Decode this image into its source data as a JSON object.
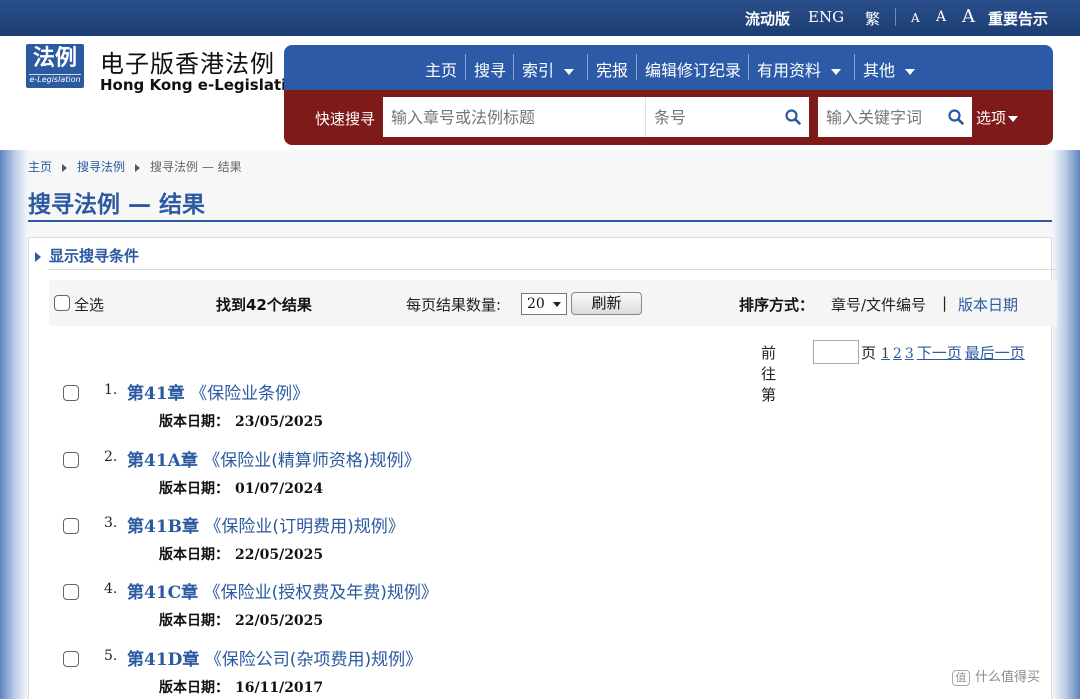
{
  "topbar": {
    "mobile": "流动版",
    "english": "ENG",
    "traditional": "繁",
    "font_small": "A",
    "font_medium": "A",
    "font_large": "A",
    "notice": "重要告示"
  },
  "header": {
    "logo_cn": "法例",
    "logo_en": "e-Legislation",
    "site_cn": "电子版香港法例",
    "site_en": "Hong Kong e-Legislation"
  },
  "nav": {
    "home": "主页",
    "search": "搜寻",
    "index": "索引",
    "constitution": "宪报",
    "editorial": "编辑修订纪录",
    "useful": "有用资料",
    "others": "其他"
  },
  "quick_search": {
    "label": "快速搜寻",
    "chapter_placeholder": "输入章号或法例标题",
    "section_placeholder": "条号",
    "keyword_placeholder": "输入关键字词",
    "options": "选项"
  },
  "breadcrumb": {
    "home": "主页",
    "search": "搜寻法例",
    "current": "搜寻法例 — 结果"
  },
  "page_title": "搜寻法例 — 结果",
  "search_conditions": "显示搜寻条件",
  "toolbar": {
    "select_all": "全选",
    "found": "找到42个结果",
    "per_page_label": "每页结果数量:",
    "per_page_value": "20",
    "refresh": "刷新",
    "sort_label": "排序方式：",
    "sort_chapter": "章号/文件编号",
    "sort_sep": "|",
    "sort_date": "版本日期"
  },
  "pager": {
    "goto": "前往第",
    "page": "页",
    "current": "1",
    "p2": "2",
    "p3": "3",
    "next": "下一页",
    "last": "最后一页"
  },
  "results": [
    {
      "index": "1.",
      "chapter": "第41章",
      "title": "《保险业条例》",
      "version_label": "版本日期：",
      "version_date": "23/05/2025"
    },
    {
      "index": "2.",
      "chapter": "第41A章",
      "title": "《保险业(精算师资格)规例》",
      "version_label": "版本日期：",
      "version_date": "01/07/2024"
    },
    {
      "index": "3.",
      "chapter": "第41B章",
      "title": "《保险业(订明费用)规例》",
      "version_label": "版本日期：",
      "version_date": "22/05/2025"
    },
    {
      "index": "4.",
      "chapter": "第41C章",
      "title": "《保险业(授权费及年费)规例》",
      "version_label": "版本日期：",
      "version_date": "22/05/2025"
    },
    {
      "index": "5.",
      "chapter": "第41D章",
      "title": "《保险公司(杂项费用)规例》",
      "version_label": "版本日期：",
      "version_date": "16/11/2017"
    }
  ],
  "watermark": "什么值得买",
  "watermark_icon": "值"
}
